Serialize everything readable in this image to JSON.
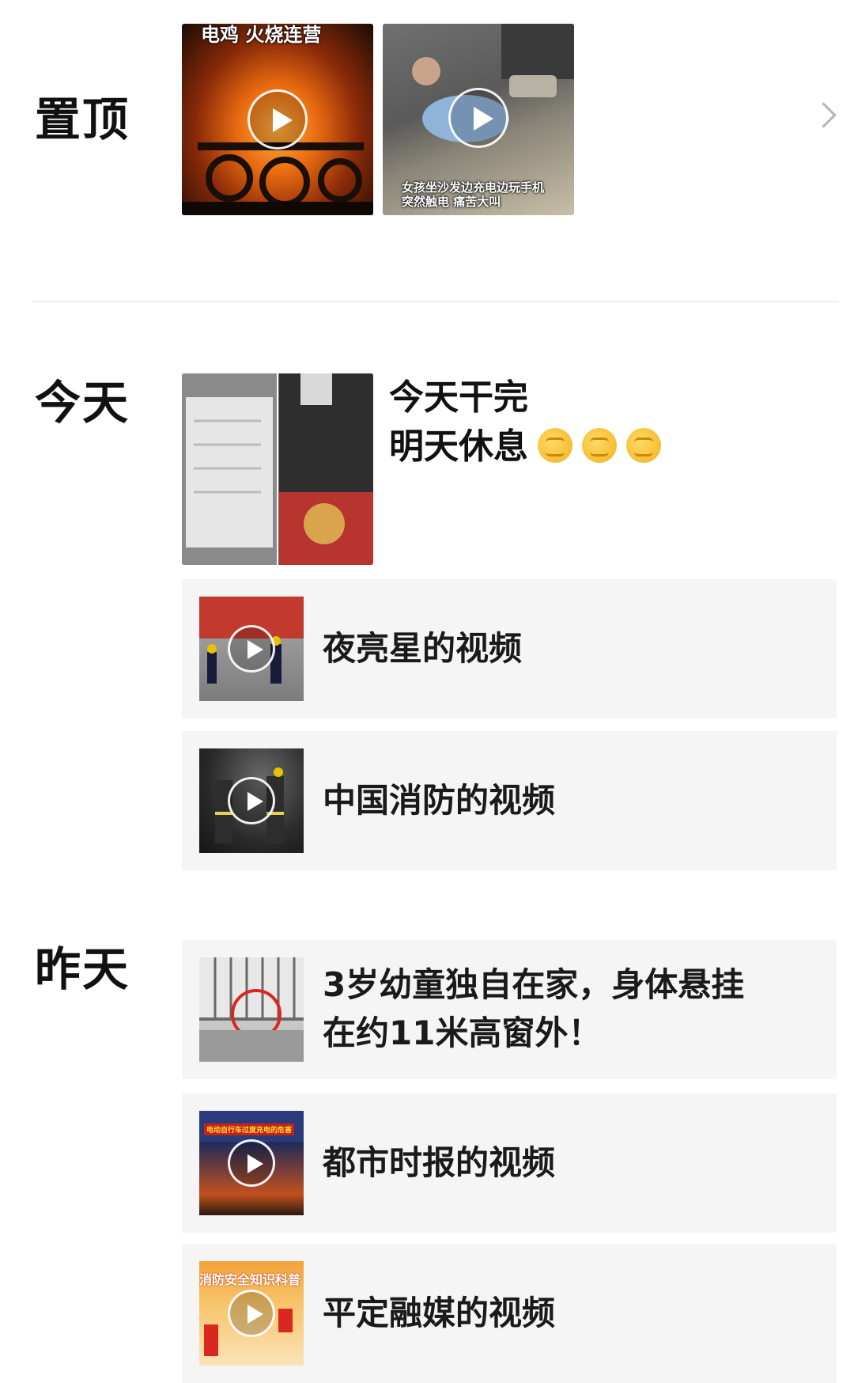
{
  "sections": {
    "pinned": {
      "label": "置顶",
      "thumb1_caption": "电鸡 火烧连营",
      "thumb2_caption_line1": "女孩坐沙发边充电边玩手机",
      "thumb2_caption_line2": "突然触电 痛苦大叫"
    },
    "today": {
      "label": "今天",
      "post_line1": "今天干完",
      "post_line2": "明天休息",
      "post_emoji": "✊",
      "cards": [
        {
          "title": "夜亮星的视频"
        },
        {
          "title": "中国消防的视频"
        }
      ]
    },
    "yesterday": {
      "label": "昨天",
      "cards": [
        {
          "title_line1": "3岁幼童独自在家，身体悬挂",
          "title_line2": "在约11米高窗外！"
        },
        {
          "title": "都市时报的视频",
          "thumb_caption": "电动自行车过度充电的危害"
        },
        {
          "title": "平定融媒的视频",
          "thumb_caption": "消防安全知识科普"
        }
      ]
    }
  },
  "icons": {
    "more": "chevron-right-icon",
    "play": "play-icon",
    "emoji": "fist-emoji-icon"
  },
  "colors": {
    "card_bg": "#f5f5f5",
    "divider": "#eeeeee",
    "chevron": "#b5b5b5"
  }
}
